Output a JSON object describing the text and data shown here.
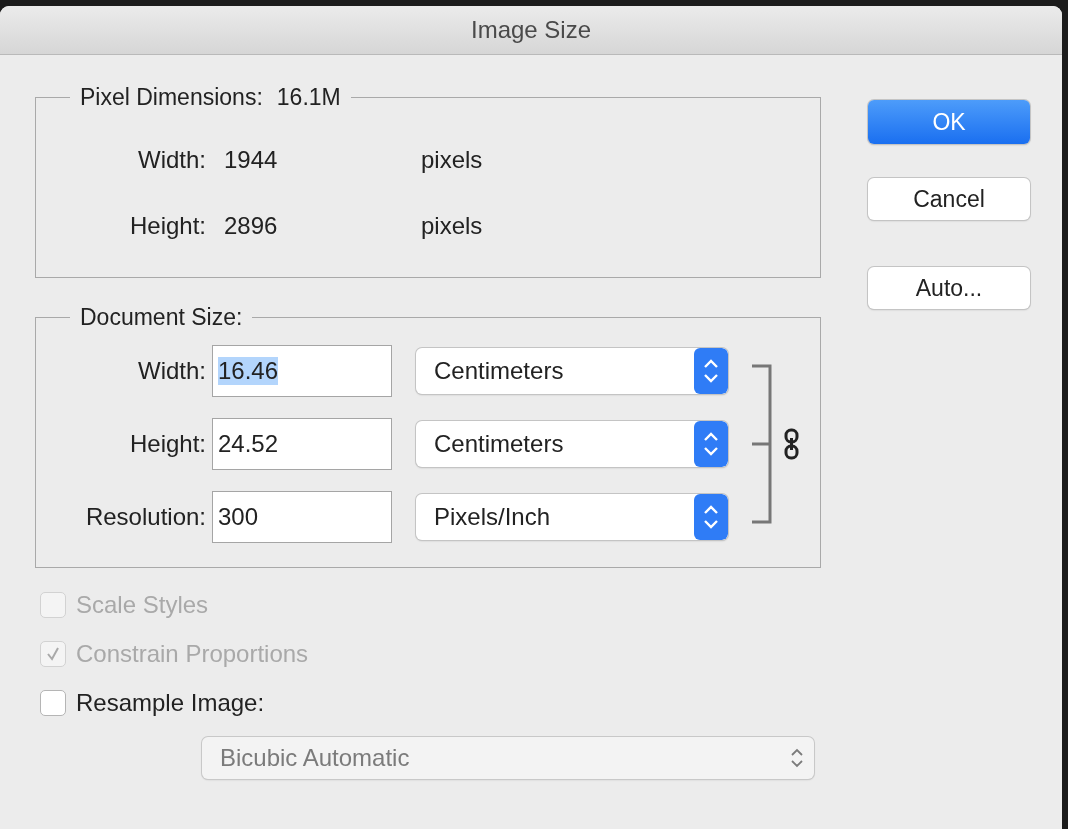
{
  "window": {
    "title": "Image Size"
  },
  "pixel_dimensions": {
    "label": "Pixel Dimensions:",
    "value": "16.1M",
    "rows": [
      {
        "label": "Width:",
        "value": "1944",
        "unit": "pixels"
      },
      {
        "label": "Height:",
        "value": "2896",
        "unit": "pixels"
      }
    ]
  },
  "document_size": {
    "label": "Document Size:",
    "rows": [
      {
        "label": "Width:",
        "value": "16.46",
        "selected": true,
        "unit": "Centimeters"
      },
      {
        "label": "Height:",
        "value": "24.52",
        "selected": false,
        "unit": "Centimeters"
      },
      {
        "label": "Resolution:",
        "value": "300",
        "selected": false,
        "unit": "Pixels/Inch"
      }
    ]
  },
  "options": [
    {
      "label": "Scale Styles",
      "checked": false,
      "disabled": true
    },
    {
      "label": "Constrain Proportions",
      "checked": true,
      "disabled": true
    },
    {
      "label": "Resample Image:",
      "checked": false,
      "disabled": false
    }
  ],
  "resample_method": {
    "value": "Bicubic Automatic",
    "disabled": true
  },
  "buttons": [
    {
      "label": "OK",
      "default": true
    },
    {
      "label": "Cancel",
      "default": false
    },
    {
      "label": "Auto...",
      "default": false
    }
  ]
}
